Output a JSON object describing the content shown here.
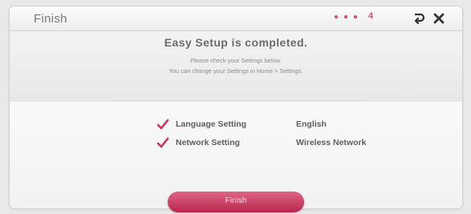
{
  "header": {
    "title": "Finish",
    "step_indicator": "4",
    "back_icon": "back-arrow-icon",
    "close_icon": "close-icon"
  },
  "main": {
    "headline": "Easy Setup is completed.",
    "instruction_line1": "Please check your Settings below.",
    "instruction_line2": "You can change your Settings in Home > Settings."
  },
  "settings": [
    {
      "label": "Language Setting",
      "value": "English",
      "icon": "checkmark-icon"
    },
    {
      "label": "Network Setting",
      "value": "Wireless Network",
      "icon": "checkmark-icon"
    }
  ],
  "footer": {
    "finish_label": "Finish"
  },
  "colors": {
    "accent": "#c8345a",
    "text": "#5e5e5e",
    "background": "#e9e9e9"
  }
}
